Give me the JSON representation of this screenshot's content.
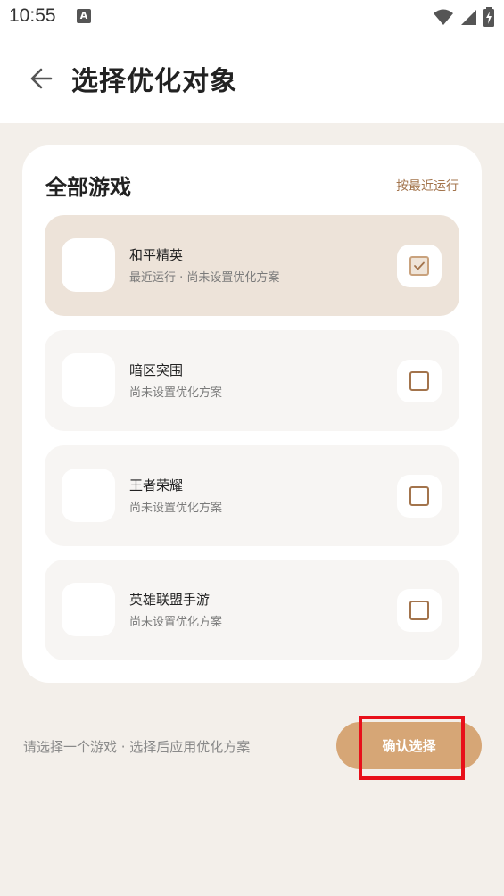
{
  "status_bar": {
    "time": "10:55",
    "app_icon_letter": "A",
    "icons": [
      "wifi-icon",
      "signal-icon",
      "battery-charging-icon"
    ]
  },
  "header": {
    "back_icon": "arrow-left-icon",
    "title": "选择优化对象"
  },
  "card": {
    "title": "全部游戏",
    "sort_label": "按最近运行",
    "games": [
      {
        "name": "和平精英",
        "subtitle": "最近运行 · 尚未设置优化方案",
        "selected": true
      },
      {
        "name": "暗区突围",
        "subtitle": "尚未设置优化方案",
        "selected": false
      },
      {
        "name": "王者荣耀",
        "subtitle": "尚未设置优化方案",
        "selected": false
      },
      {
        "name": "英雄联盟手游",
        "subtitle": "尚未设置优化方案",
        "selected": false
      }
    ]
  },
  "footer": {
    "hint": "请选择一个游戏 · 选择后应用优化方案",
    "confirm_label": "确认选择"
  },
  "colors": {
    "accent": "#d6a676",
    "accent_text": "#a3744c",
    "selected_bg": "#ede3d9",
    "page_bg": "#f3efea",
    "highlight": "#e8101a"
  }
}
